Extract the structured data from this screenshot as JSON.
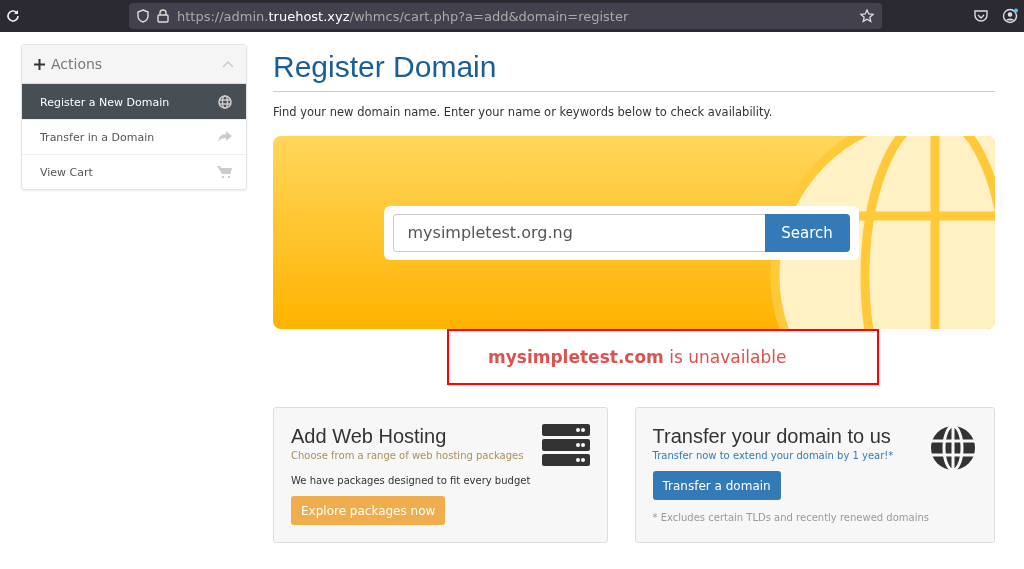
{
  "browser": {
    "url": "https://admin.**truehost.xyz**/whmcs/cart.php?a=add&domain=register"
  },
  "sidebar": {
    "title": "Actions",
    "items": [
      {
        "label": "Register a New Domain",
        "selected": true
      },
      {
        "label": "Transfer in a Domain",
        "selected": false
      },
      {
        "label": "View Cart",
        "selected": false
      }
    ]
  },
  "page": {
    "title": "Register Domain",
    "intro": "Find your new domain name. Enter your name or keywords below to check availability."
  },
  "search": {
    "value": "mysimpletest.org.ng",
    "button": "Search"
  },
  "result": {
    "message": "**mysimpletest.com** is unavailable"
  },
  "cards": [
    {
      "title": "Add Web Hosting",
      "subtitle": "Choose from a range of web hosting packages",
      "body": "We have packages designed to fit every budget",
      "button": "Explore packages now",
      "kind": "hosting"
    },
    {
      "title": "Transfer your domain to us",
      "subtitle": "Transfer now to extend your domain by 1 year!*",
      "button": "Transfer a domain",
      "note": "* Excludes certain TLDs and recently renewed domains",
      "kind": "transfer"
    }
  ]
}
